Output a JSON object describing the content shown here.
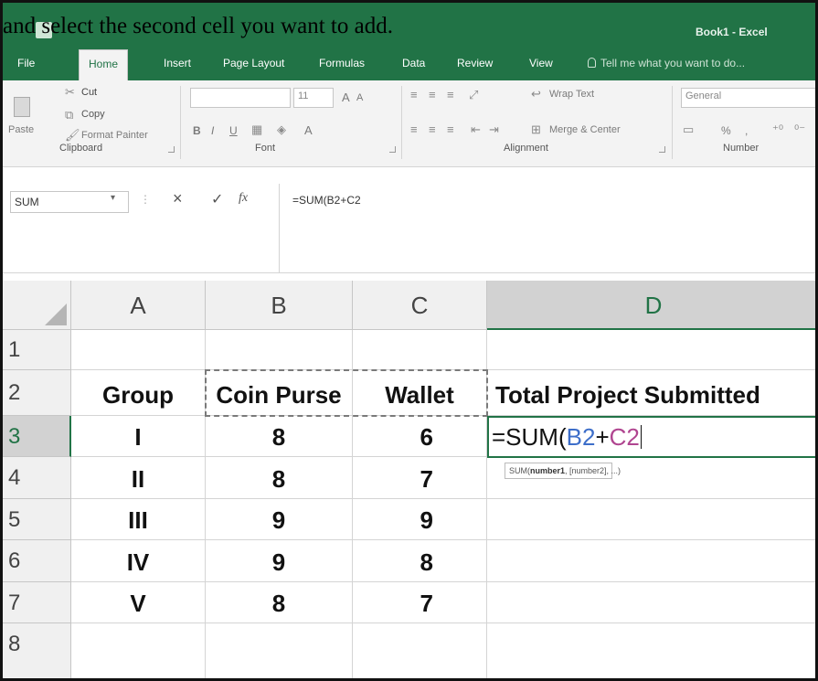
{
  "instruction": "and select the second cell you want to add.",
  "title": "Book1 - Excel",
  "tabs": [
    "File",
    "Home",
    "Insert",
    "Page Layout",
    "Formulas",
    "Data",
    "Review",
    "View"
  ],
  "tell_me": "Tell me what you want to do...",
  "ribbon": {
    "clipboard": {
      "paste": "Paste",
      "cut": "Cut",
      "copy": "Copy",
      "format_painter": "Format Painter",
      "label": "Clipboard"
    },
    "font": {
      "size": "11",
      "grow": "A",
      "shrink": "A",
      "bold": "B",
      "italic": "I",
      "underline": "U",
      "color_a": "A",
      "label": "Font"
    },
    "alignment": {
      "wrap": "Wrap Text",
      "merge": "Merge & Center",
      "label": "Alignment"
    },
    "number": {
      "format": "General",
      "percent": "%",
      "comma": ",",
      "label": "Number"
    }
  },
  "formula_bar": {
    "name_box": "SUM",
    "fx": "fx",
    "formula": "=SUM(B2+C2"
  },
  "columns": [
    "A",
    "B",
    "C",
    "D"
  ],
  "rows": [
    "1",
    "2",
    "3",
    "4",
    "5",
    "6",
    "7",
    "8"
  ],
  "table": {
    "headers": [
      "Group",
      "Coin Purse",
      "Wallet",
      "Total Project Submitted"
    ],
    "data": [
      [
        "I",
        "8",
        "6"
      ],
      [
        "II",
        "8",
        "7"
      ],
      [
        "III",
        "9",
        "9"
      ],
      [
        "IV",
        "9",
        "8"
      ],
      [
        "V",
        "8",
        "7"
      ]
    ]
  },
  "active_cell": {
    "prefix": "=SUM(",
    "ref1": "B2",
    "op": "+",
    "ref2": "C2"
  },
  "tooltip": {
    "fn": "SUM(",
    "arg1": "number1",
    "rest": ", [number2], ...)"
  },
  "colors": {
    "excel_green": "#217346",
    "ref1": "#3d6ec9",
    "ref2": "#b04590"
  }
}
